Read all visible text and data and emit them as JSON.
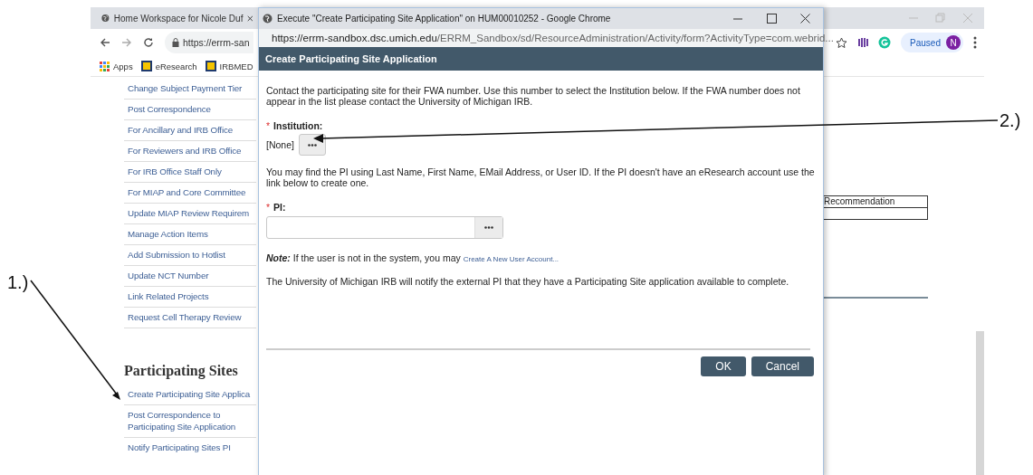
{
  "background_window": {
    "tab_title": "Home Workspace for Nicole Duf",
    "address": "https://errm-san",
    "bookmarks": [
      {
        "label": "Apps",
        "kind": "apps"
      },
      {
        "label": "eResearch",
        "kind": "logo"
      },
      {
        "label": "IRBMED",
        "kind": "logo"
      }
    ],
    "profile": {
      "label": "Paused",
      "avatar": "N"
    },
    "actions": [
      "Change Subject Payment Tier",
      "Post Correspondence",
      "For Ancillary and IRB Office",
      "For Reviewers and IRB Office",
      "For IRB Office Staff Only",
      "For MIAP and Core Committee",
      "Update MIAP Review Requirem",
      "Manage Action Items",
      "Add Submission to Hotlist",
      "Update NCT Number",
      "Link Related Projects",
      "Request Cell Therapy Review"
    ],
    "section_heading": "Participating Sites",
    "section_links": [
      "Create Participating Site Applica",
      "Post Correspondence to Participating Site Application",
      "Notify Participating Sites PI"
    ],
    "table_cell": "Recommendation"
  },
  "popup_window": {
    "title": "Execute \"Create Participating Site Application\" on HUM00010252 - Google Chrome",
    "url_host": "https://errm-sandbox.dsc.umich.edu",
    "url_path": "/ERRM_Sandbox/sd/ResourceAdministration/Activity/form?ActivityType=com.webrid...",
    "header": "Create Participating Site Application",
    "intro": "Contact the participating site for their FWA number. Use this number to select the Institution below. If the FWA number does not appear in the list please contact the University of Michigan IRB.",
    "institution": {
      "required_mark": "*",
      "label": "Institution:",
      "value": "[None]"
    },
    "pi_hint": "You may find the PI using Last Name, First Name, EMail Address, or User ID. If the PI doesn't have an eResearch account use the link below to create one.",
    "pi": {
      "required_mark": "*",
      "label": "PI:"
    },
    "note": "**Note:** If the user is not in the system, you may",
    "note_link": "Create A New User Account...",
    "notify": "The University of Michigan IRB will notify the external PI that they have a Participating Site application available to complete.",
    "buttons": [
      "OK",
      "Cancel"
    ]
  },
  "annotations": [
    {
      "label": "1.)"
    },
    {
      "label": "2.)"
    }
  ]
}
